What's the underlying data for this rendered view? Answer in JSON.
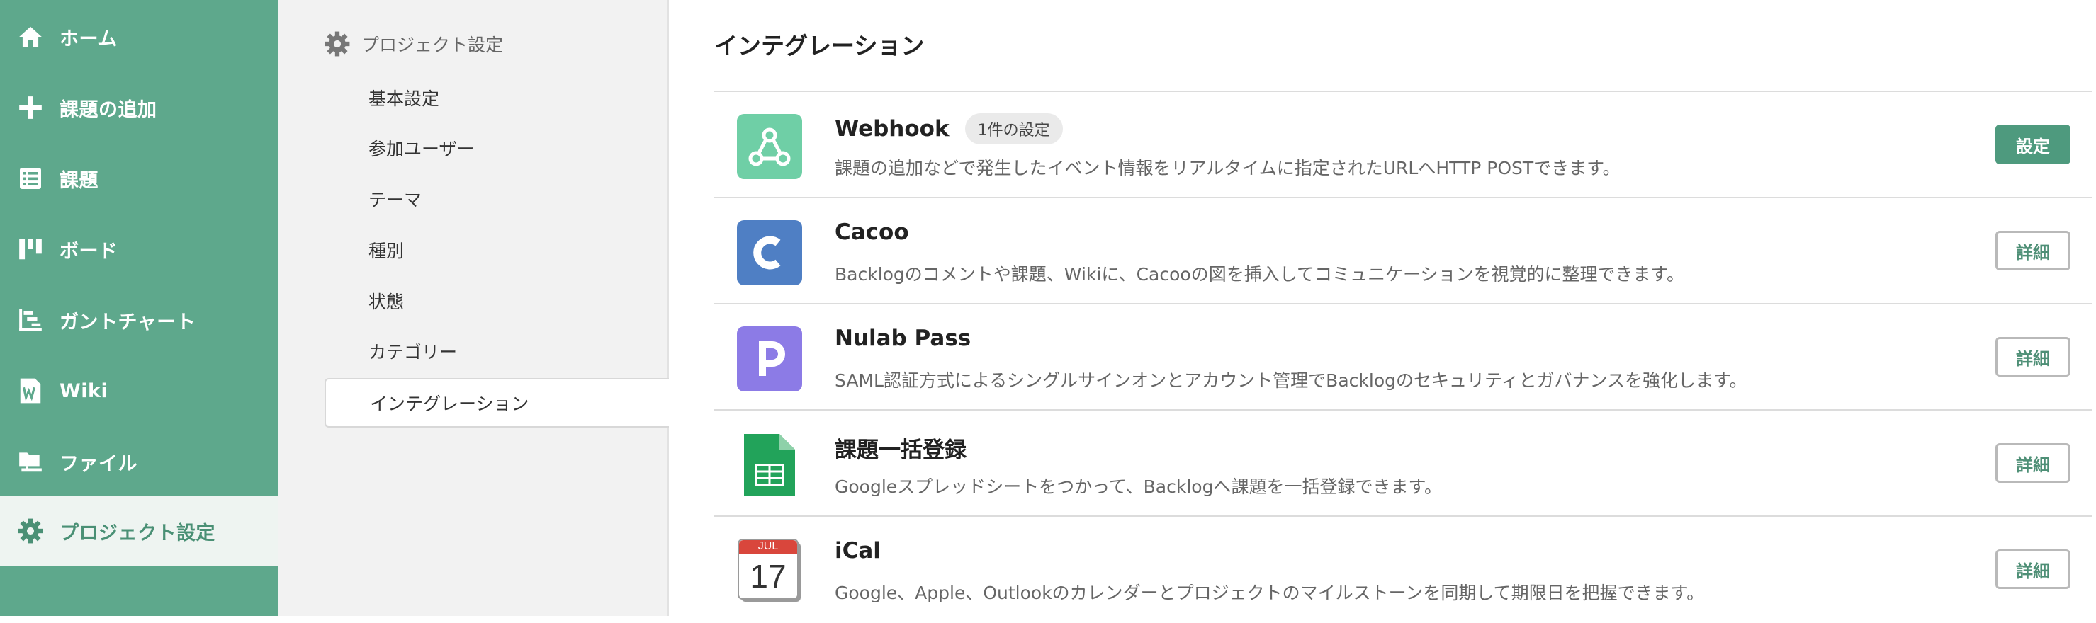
{
  "nav": {
    "items": [
      {
        "label": "ホーム",
        "icon": "home-icon"
      },
      {
        "label": "課題の追加",
        "icon": "plus-icon"
      },
      {
        "label": "課題",
        "icon": "list-icon"
      },
      {
        "label": "ボード",
        "icon": "board-icon"
      },
      {
        "label": "ガントチャート",
        "icon": "gantt-icon"
      },
      {
        "label": "Wiki",
        "icon": "wiki-icon"
      },
      {
        "label": "ファイル",
        "icon": "folder-icon"
      },
      {
        "label": "プロジェクト設定",
        "icon": "gear-icon",
        "active": true
      }
    ],
    "colors": {
      "background": "#5ea88c",
      "active_background": "#eef4f1",
      "active_text": "#4a9075"
    }
  },
  "subnav": {
    "header": "プロジェクト設定",
    "items": [
      {
        "label": "基本設定"
      },
      {
        "label": "参加ユーザー"
      },
      {
        "label": "テーマ"
      },
      {
        "label": "種別"
      },
      {
        "label": "状態"
      },
      {
        "label": "カテゴリー"
      },
      {
        "label": "インテグレーション",
        "active": true
      }
    ]
  },
  "main": {
    "title": "インテグレーション",
    "integrations": [
      {
        "name": "Webhook",
        "badge": "1件の設定",
        "description": "課題の追加などで発生したイベント情報をリアルタイムに指定されたURLへHTTP POSTできます。",
        "button": "設定",
        "icon": "webhook-icon"
      },
      {
        "name": "Cacoo",
        "description": "Backlogのコメントや課題、Wikiに、Cacooの図を挿入してコミュニケーションを視覚的に整理できます。",
        "button": "詳細",
        "icon": "cacoo-icon"
      },
      {
        "name": "Nulab Pass",
        "description": "SAML認証方式によるシングルサインオンとアカウント管理でBacklogのセキュリティとガバナンスを強化します。",
        "button": "詳細",
        "icon": "nulab-pass-icon"
      },
      {
        "name": "課題一括登録",
        "description": "Googleスプレッドシートをつかって、Backlogへ課題を一括登録できます。",
        "button": "詳細",
        "icon": "spreadsheet-icon"
      },
      {
        "name": "iCal",
        "description": "Google、Apple、Outlookのカレンダーとプロジェクトのマイルストーンを同期して期限日を把握できます。",
        "button": "詳細",
        "icon": "calendar-icon",
        "calendar_month": "JUL",
        "calendar_day": "17"
      }
    ]
  }
}
